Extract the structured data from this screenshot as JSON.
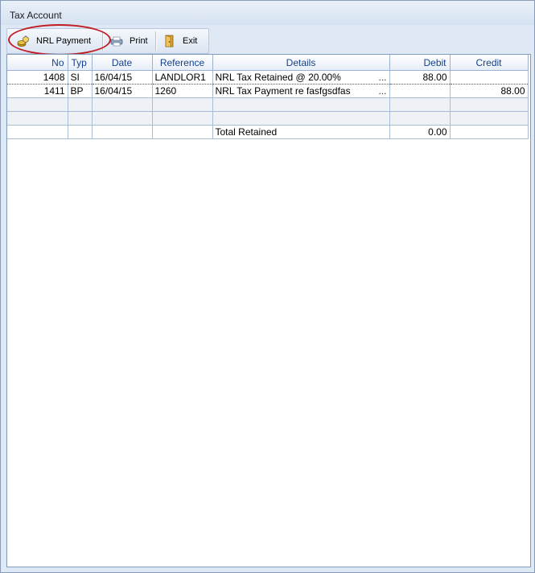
{
  "window": {
    "title": "Tax Account"
  },
  "toolbar": {
    "nrl_payment_label": "NRL Payment",
    "print_label": "Print",
    "exit_label": "Exit",
    "icons": [
      "coins-icon",
      "printer-icon",
      "exit-door-icon"
    ],
    "highlight_color": "#c21c24"
  },
  "grid": {
    "columns": [
      "No",
      "Typ",
      "Date",
      "Reference",
      "Details",
      "Debit",
      "Credit"
    ],
    "rows": [
      {
        "no": "1408",
        "typ": "SI",
        "date": "16/04/15",
        "reference": "LANDLOR1",
        "details": "NRL Tax Retained @ 20.00%",
        "details_more": "...",
        "debit": "88.00",
        "credit": ""
      },
      {
        "no": "1411",
        "typ": "BP",
        "date": "16/04/15",
        "reference": "1260",
        "details": "NRL Tax Payment re fasfgsdfas",
        "details_more": "...",
        "debit": "",
        "credit": "88.00"
      }
    ],
    "total": {
      "label": "Total Retained",
      "debit": "0.00",
      "credit": ""
    }
  }
}
